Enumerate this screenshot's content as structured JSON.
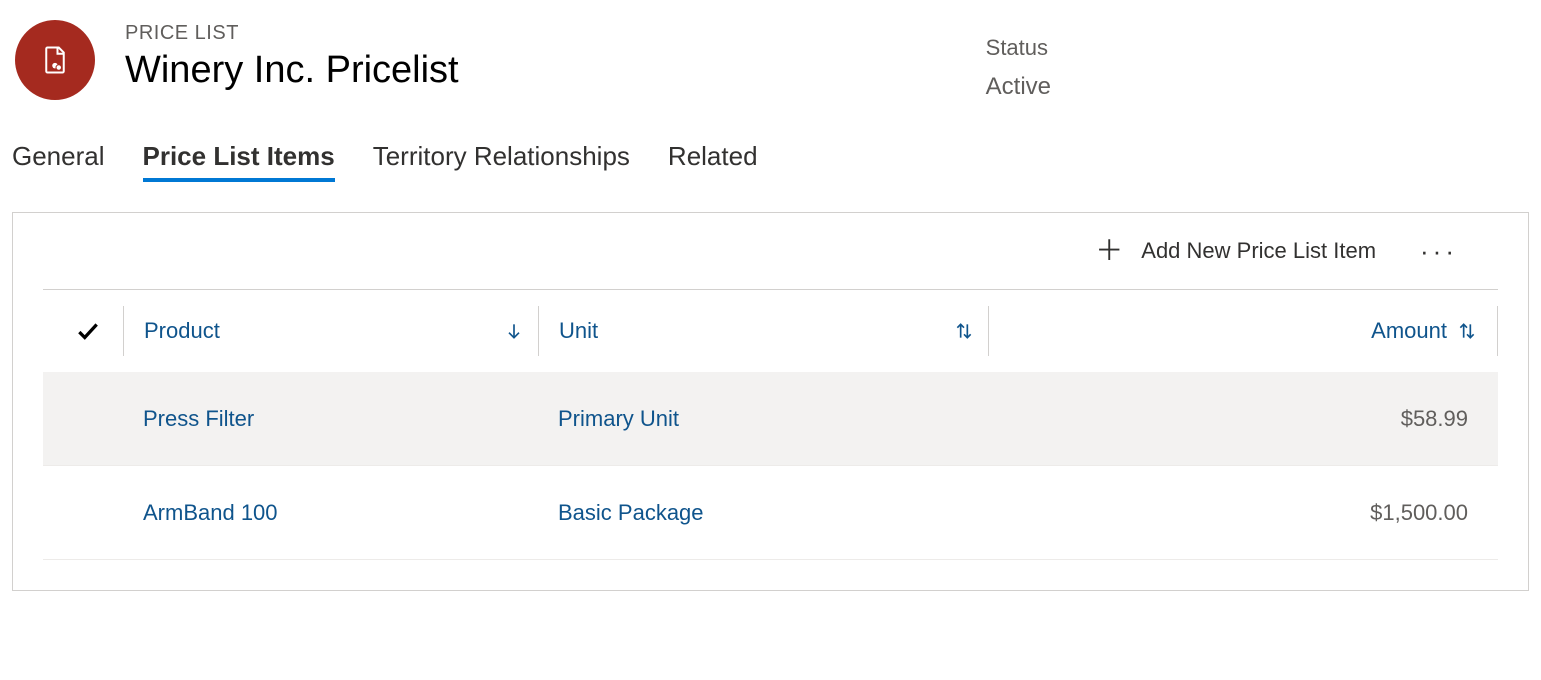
{
  "header": {
    "entity_type": "PRICE LIST",
    "title": "Winery Inc. Pricelist",
    "status_label": "Status",
    "status_value": "Active"
  },
  "tabs": {
    "general": "General",
    "price_list_items": "Price List Items",
    "territory": "Territory Relationships",
    "related": "Related"
  },
  "toolbar": {
    "add_label": "Add New Price List Item"
  },
  "columns": {
    "product": "Product",
    "unit": "Unit",
    "amount": "Amount"
  },
  "rows": [
    {
      "product": "Press Filter",
      "unit": "Primary Unit",
      "amount": "$58.99"
    },
    {
      "product": "ArmBand 100",
      "unit": "Basic Package",
      "amount": "$1,500.00"
    }
  ]
}
